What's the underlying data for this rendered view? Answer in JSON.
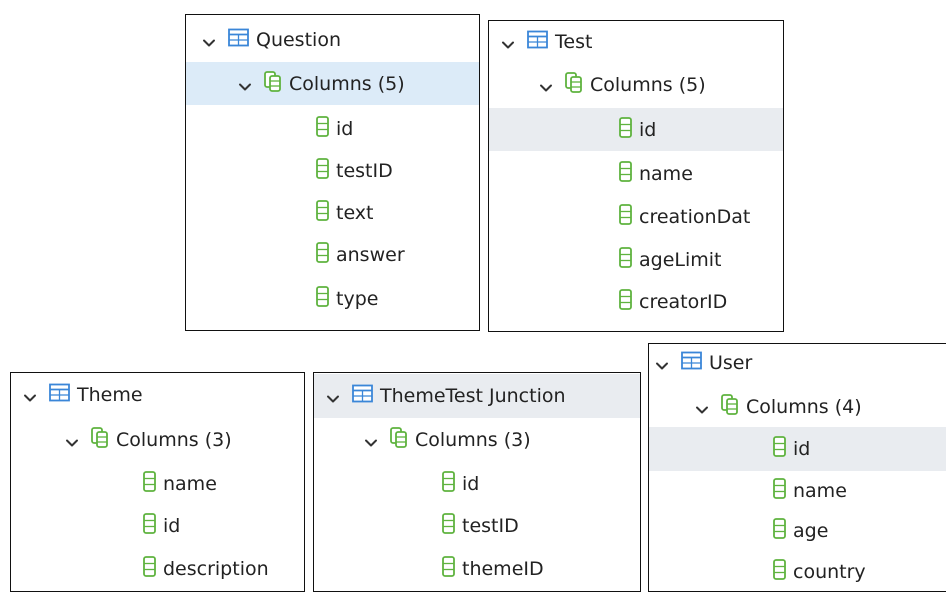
{
  "colors": {
    "table_icon": "#3a86d8",
    "column_icon": "#5fb33f",
    "selected_row": "#dcebf8",
    "hover_row": "#e9ecf0"
  },
  "icons": {
    "expand": "chevron-down-icon",
    "table": "table-icon",
    "columns_group": "columns-icon",
    "column": "column-icon"
  },
  "panels": [
    {
      "table": "Question",
      "columns_label": "Columns (5)",
      "columns": [
        "id",
        "testID",
        "text",
        "answer",
        "type"
      ]
    },
    {
      "table": "Test",
      "columns_label": "Columns (5)",
      "columns": [
        "id",
        "name",
        "creationDat",
        "ageLimit",
        "creatorID"
      ]
    },
    {
      "table": "Theme",
      "columns_label": "Columns (3)",
      "columns": [
        "name",
        "id",
        "description"
      ]
    },
    {
      "table": "ThemeTest Junction",
      "columns_label": "Columns (3)",
      "columns": [
        "id",
        "testID",
        "themeID"
      ]
    },
    {
      "table": "User",
      "columns_label": "Columns (4)",
      "columns": [
        "id",
        "name",
        "age",
        "country"
      ]
    }
  ]
}
